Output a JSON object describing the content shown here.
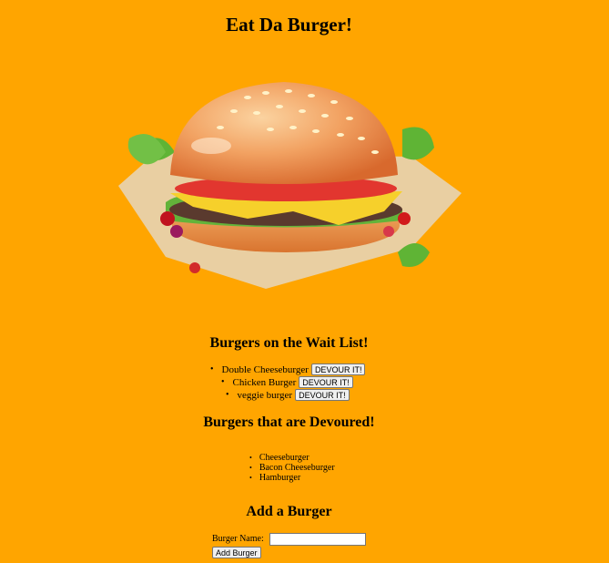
{
  "page": {
    "title": "Eat Da Burger!"
  },
  "hero_image": {
    "alt": "burger illustration"
  },
  "wait_list": {
    "heading": "Burgers on the Wait List!",
    "devour_label": "DEVOUR IT!",
    "items": [
      "Double Cheeseburger",
      "Chicken Burger",
      "veggie burger"
    ]
  },
  "devoured": {
    "heading": "Burgers that are Devoured!",
    "items": [
      "Cheeseburger",
      "Bacon Cheeseburger",
      "Hamburger"
    ]
  },
  "add_form": {
    "heading": "Add a Burger",
    "name_label": "Burger Name:",
    "name_value": "",
    "submit_label": "Add Burger"
  },
  "colors": {
    "background": "#FFA500"
  }
}
